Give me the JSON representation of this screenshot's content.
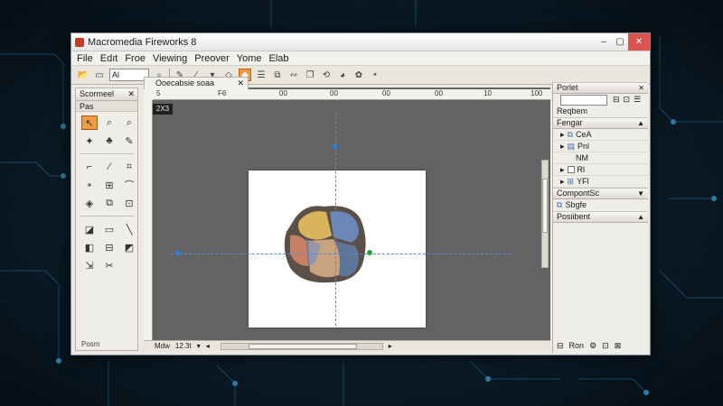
{
  "window": {
    "title": "Macromedia Fireworks 8"
  },
  "menu": [
    "File",
    "Edıt",
    "Froe",
    "Viewing",
    "Preover",
    "Yome",
    "Elab"
  ],
  "toolbar": {
    "zoom_select": "Al"
  },
  "tools_panel": {
    "title": "Scormeel",
    "subtitle": "Pas",
    "status": "Posm"
  },
  "document": {
    "tab_label": "Ooecabsie soaa",
    "mode_badge": "2X3",
    "ruler_marks": [
      "5",
      "F6",
      "00",
      "00",
      "00",
      "00",
      "10",
      "100"
    ],
    "status_mode": "Mdw",
    "status_zoom": "12.3t"
  },
  "right_panel": {
    "title": "Porlet",
    "row1": "Reqbem",
    "section1": "Fengar",
    "layers": [
      {
        "name": "CeA",
        "icon": "folder-icon"
      },
      {
        "name": "Pnl",
        "icon": "layer-icon"
      },
      {
        "name": "NM",
        "icon": "none"
      },
      {
        "name": "Rl",
        "icon": "layer-icon"
      },
      {
        "name": "YFl",
        "icon": "layer-icon"
      }
    ],
    "section2": "CompontSc",
    "section2_item": "Sbgfe",
    "section3": "Posiibent",
    "bottom": "Ron"
  },
  "colors": {
    "accent": "#f29b45",
    "guide": "#4d8fd6"
  }
}
